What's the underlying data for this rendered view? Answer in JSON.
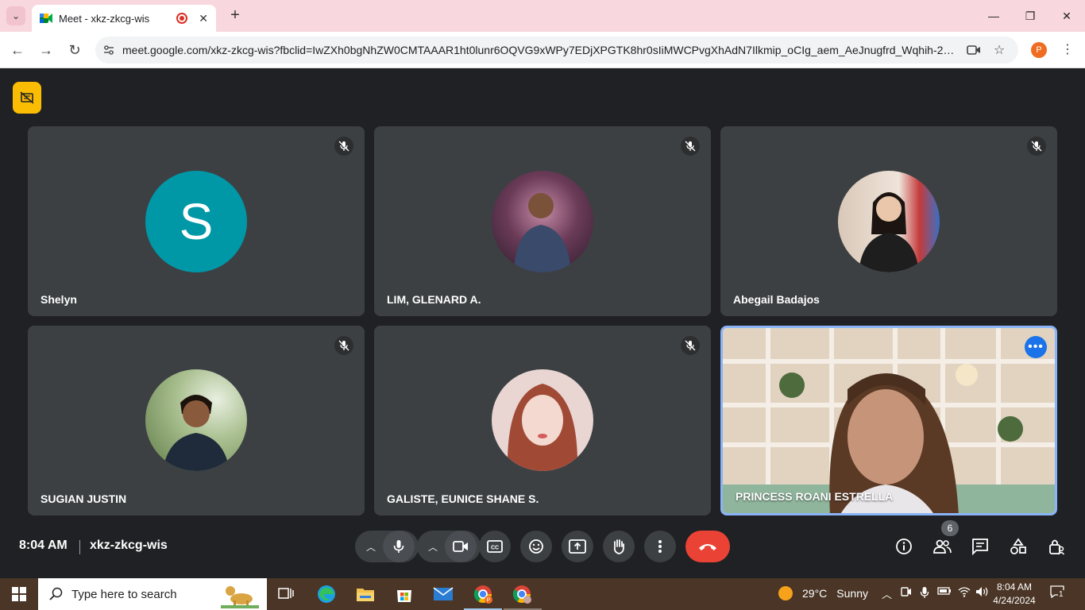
{
  "browser": {
    "tab_title": "Meet - xkz-zkcg-wis",
    "url": "meet.google.com/xkz-zkcg-wis?fbclid=IwZXh0bgNhZW0CMTAAAR1ht0lunr6OQVG9xWPy7EDjXPGTK8hr0sIiMWCPvgXhAdN7Ilkmip_oCIg_aem_AeJnugfrd_Wqhih-2bOna...",
    "profile_initial": "P"
  },
  "participants": [
    {
      "name": "Shelyn",
      "avatar_letter": "S",
      "avatar_color": "#0097a7"
    },
    {
      "name": "LIM, GLENARD A."
    },
    {
      "name": "Abegail Badajos"
    },
    {
      "name": "SUGIAN JUSTIN"
    },
    {
      "name": "GALISTE, EUNICE SHANE S."
    },
    {
      "name": "PRINCESS ROANI ESTRELLA"
    }
  ],
  "meeting": {
    "time": "8:04 AM",
    "code": "xkz-zkcg-wis",
    "participant_count": "6"
  },
  "taskbar": {
    "search_placeholder": "Type here to search",
    "weather_temp": "29°C",
    "weather_desc": "Sunny",
    "time": "8:04 AM",
    "date": "4/24/2024",
    "notifications": "1"
  },
  "colors": {
    "accent_blue": "#1a73e8",
    "leave_red": "#ea4335",
    "yellow": "#fbbc04"
  }
}
